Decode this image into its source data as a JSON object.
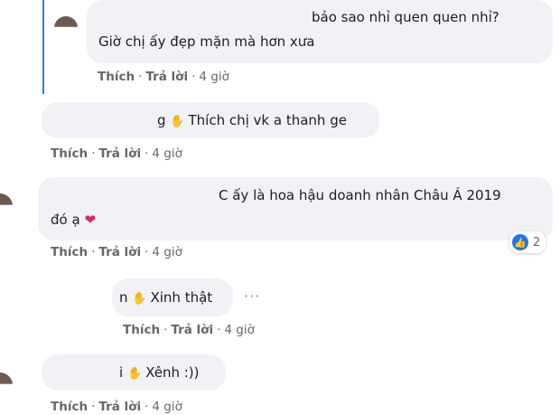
{
  "comments": [
    {
      "line1": "bảo sao nhỉ quen quen nhỉ?",
      "line2": "Giờ chị ấy đẹp mặn mà hơn xưa",
      "actions": {
        "like": "Thích",
        "reply": "Trả lời",
        "time": "4 giờ"
      }
    },
    {
      "prefix": "g",
      "text": "Thích chị vk a thanh ge",
      "actions": {
        "like": "Thích",
        "reply": "Trả lời",
        "time": "4 giờ"
      }
    },
    {
      "line1": "C ấy là hoa hậu doanh nhân Châu Á 2019",
      "line2": "đó ạ",
      "reaction_count": "2",
      "actions": {
        "like": "Thích",
        "reply": "Trả lời",
        "time": "4 giờ"
      }
    },
    {
      "prefix": "n",
      "text": "Xinh thật",
      "more": "···",
      "actions": {
        "like": "Thích",
        "reply": "Trả lời",
        "time": "4 giờ"
      }
    },
    {
      "prefix": "i",
      "text": "Xênh :))",
      "actions": {
        "like": "Thích",
        "reply": "Trả lời",
        "time": "4 giờ"
      }
    }
  ],
  "icons": {
    "wave": "waving-hand-icon",
    "heart": "red-heart-icon",
    "like": "like-reaction-icon"
  }
}
